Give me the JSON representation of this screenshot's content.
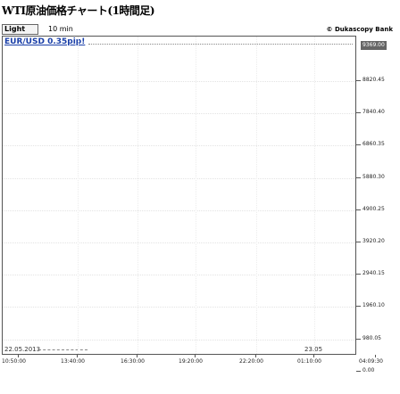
{
  "title": "WTI原油価格チャート(1時間足)",
  "toolbar": {
    "light_label": "Light",
    "interval": "10 min",
    "copyright": "© Dukascopy Bank"
  },
  "chart": {
    "instrument_label": "EUR/USD 0.35pip!",
    "last_value": "9369.00",
    "start_date": "22.05.2013",
    "end_date": "23.05",
    "y_ticks": [
      "8820.45",
      "7840.40",
      "6860.35",
      "5880.30",
      "4900.25",
      "3920.20",
      "2940.15",
      "1960.10",
      "980.05",
      "0.00"
    ],
    "x_ticks": [
      "10:50:00",
      "13:40:00",
      "16:30:00",
      "19:20:00",
      "22:20:00",
      "01:10:00",
      "04:09:30"
    ]
  },
  "chart_data": {
    "type": "line",
    "title": "EUR/USD 0.35pip!",
    "xlabel": "",
    "ylabel": "",
    "x": [
      "10:50:00",
      "13:40:00",
      "16:30:00",
      "19:20:00",
      "22:20:00",
      "01:10:00",
      "04:09:30"
    ],
    "ylim": [
      0,
      9369
    ],
    "grid": true,
    "series": []
  }
}
